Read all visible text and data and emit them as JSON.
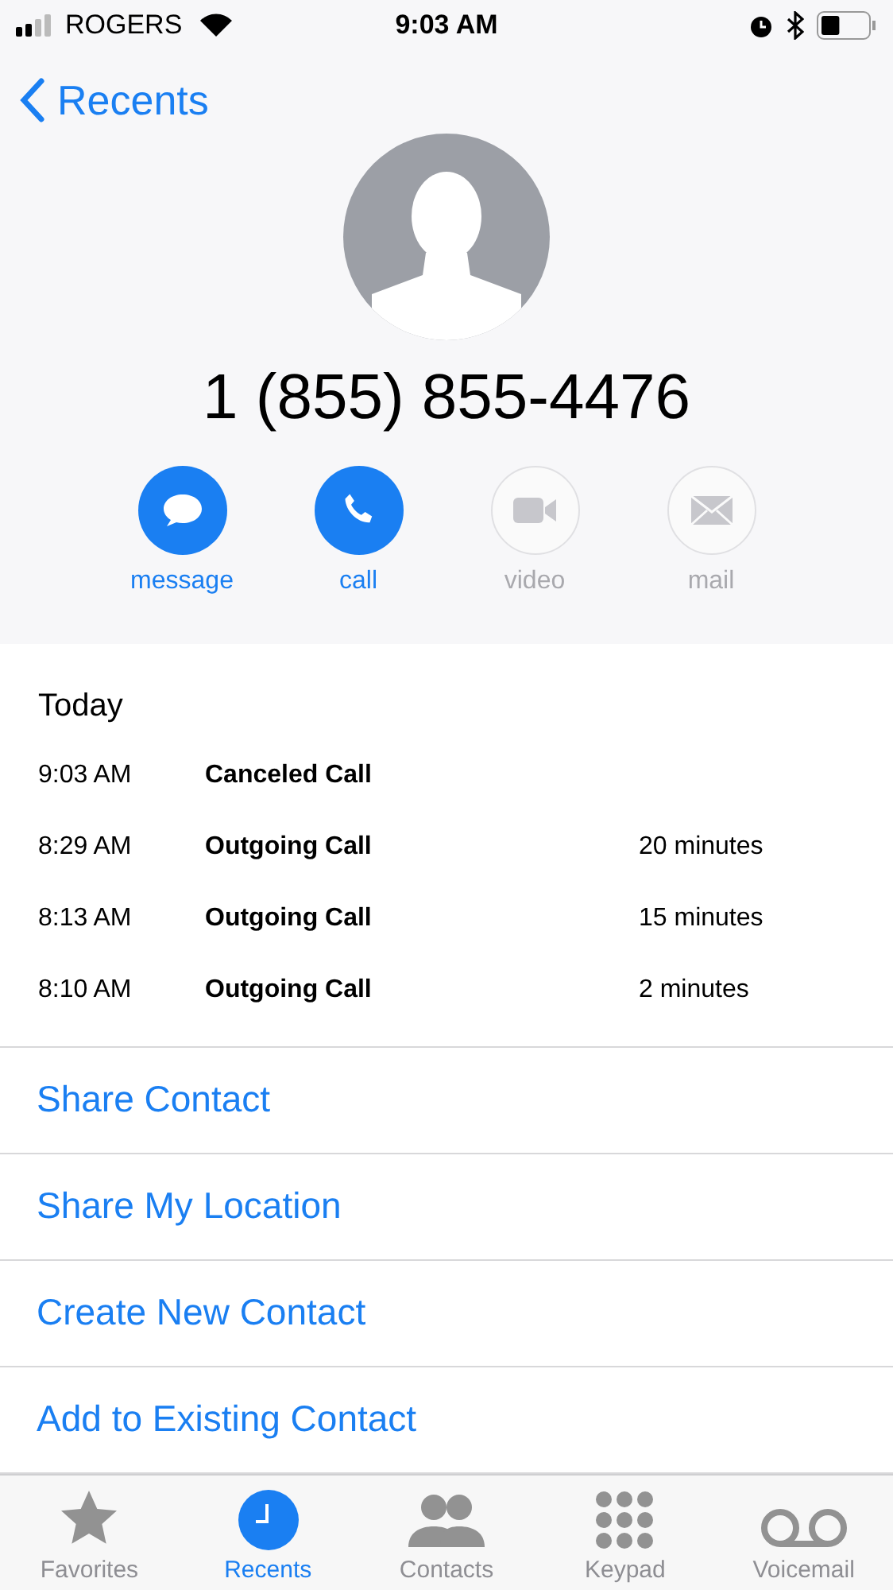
{
  "status_bar": {
    "carrier": "ROGERS",
    "time": "9:03 AM"
  },
  "nav": {
    "back": "Recents"
  },
  "contact": {
    "number": "1 (855) 855-4476"
  },
  "actions": [
    {
      "kind": "message",
      "label": "message",
      "disabled": false
    },
    {
      "kind": "call",
      "label": "call",
      "disabled": false
    },
    {
      "kind": "video",
      "label": "video",
      "disabled": true
    },
    {
      "kind": "mail",
      "label": "mail",
      "disabled": true
    }
  ],
  "history": {
    "heading": "Today",
    "rows": [
      {
        "time": "9:03 AM",
        "type": "Canceled Call"
      },
      {
        "time": "8:29 AM",
        "type": "Outgoing Call",
        "duration": "20 minutes"
      },
      {
        "time": "8:13 AM",
        "type": "Outgoing Call",
        "duration": "15 minutes"
      },
      {
        "time": "8:10 AM",
        "type": "Outgoing Call",
        "duration": "2 minutes"
      }
    ]
  },
  "options": [
    "Share Contact",
    "Share My Location",
    "Create New Contact",
    "Add to Existing Contact"
  ],
  "tabs": [
    {
      "kind": "favorites",
      "label": "Favorites",
      "selected": false
    },
    {
      "kind": "recents",
      "label": "Recents",
      "selected": true
    },
    {
      "kind": "contacts",
      "label": "Contacts",
      "selected": false
    },
    {
      "kind": "keypad",
      "label": "Keypad",
      "selected": false
    },
    {
      "kind": "voicemail",
      "label": "Voicemail",
      "selected": false
    }
  ]
}
